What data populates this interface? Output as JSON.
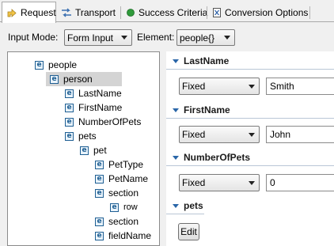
{
  "tabs": [
    {
      "label": "Request",
      "icon": "request-arrow-icon"
    },
    {
      "label": "Transport",
      "icon": "transport-icon"
    },
    {
      "label": "Success Criteria",
      "icon": "green-dot-icon"
    },
    {
      "label": "Conversion Options",
      "icon": "conversion-icon"
    }
  ],
  "mode_row": {
    "input_mode_label": "Input Mode:",
    "input_mode_value": "Form Input",
    "element_label": "Element:",
    "element_value": "people{}"
  },
  "tree": {
    "icon_letter": "e",
    "nodes": [
      {
        "label": "people"
      },
      {
        "label": "person"
      },
      {
        "label": "LastName"
      },
      {
        "label": "FirstName"
      },
      {
        "label": "NumberOfPets"
      },
      {
        "label": "pets"
      },
      {
        "label": "pet"
      },
      {
        "label": "PetType"
      },
      {
        "label": "PetName"
      },
      {
        "label": "section"
      },
      {
        "label": "row"
      },
      {
        "label": "section"
      },
      {
        "label": "fieldName"
      }
    ]
  },
  "form": {
    "fields": [
      {
        "title": "LastName",
        "mode": "Fixed",
        "value": "Smith"
      },
      {
        "title": "FirstName",
        "mode": "Fixed",
        "value": "John"
      },
      {
        "title": "NumberOfPets",
        "mode": "Fixed",
        "value": "0"
      }
    ],
    "pets_title": "pets",
    "edit_label": "Edit"
  }
}
